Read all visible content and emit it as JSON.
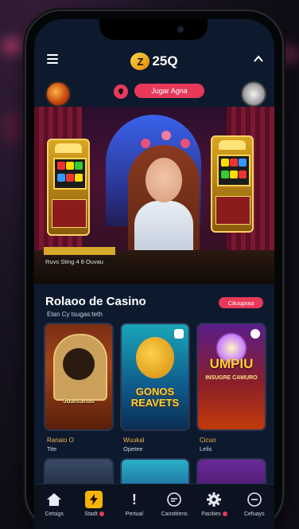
{
  "app": {
    "logo_text": "25Q",
    "logo_mark": "Z"
  },
  "header": {
    "menu_icon": "hamburger-icon",
    "collapse_icon": "chevron-up-icon"
  },
  "userbar": {
    "join_label": "Jugar Agna"
  },
  "hero": {
    "promo_title": "",
    "promo_subtitle": "Ruvs Sting 4 8 Ouvau"
  },
  "section": {
    "title": "Rolaoo de Casino",
    "subtitle": "Etan Cy tsugas:teth",
    "more_label": "Cituupraa"
  },
  "games": [
    {
      "art": "Juantanas",
      "label": "Ranaio O",
      "sub": "Tite"
    },
    {
      "art": "GONOS REAVETS",
      "label": "Wuukal",
      "sub": "Opetee"
    },
    {
      "art": "UMPIU",
      "art2": "INSUGRE CAMURO",
      "label": "Cicuo",
      "sub": "Lelis"
    }
  ],
  "tabs": [
    {
      "label": "Cetsigs",
      "icon": "home-icon"
    },
    {
      "label": "Stadt",
      "icon": "lightning-icon",
      "badge": true
    },
    {
      "label": "Pertual",
      "icon": "alert-icon"
    },
    {
      "label": "Cansttiens",
      "icon": "chat-icon"
    },
    {
      "label": "Pacities",
      "icon": "gear-icon",
      "badge": true
    },
    {
      "label": "Cefuays",
      "icon": "chat-bubble-icon"
    }
  ],
  "colors": {
    "accent": "#e8395b",
    "background": "#0d1a2e",
    "gold": "#f2b24a"
  }
}
